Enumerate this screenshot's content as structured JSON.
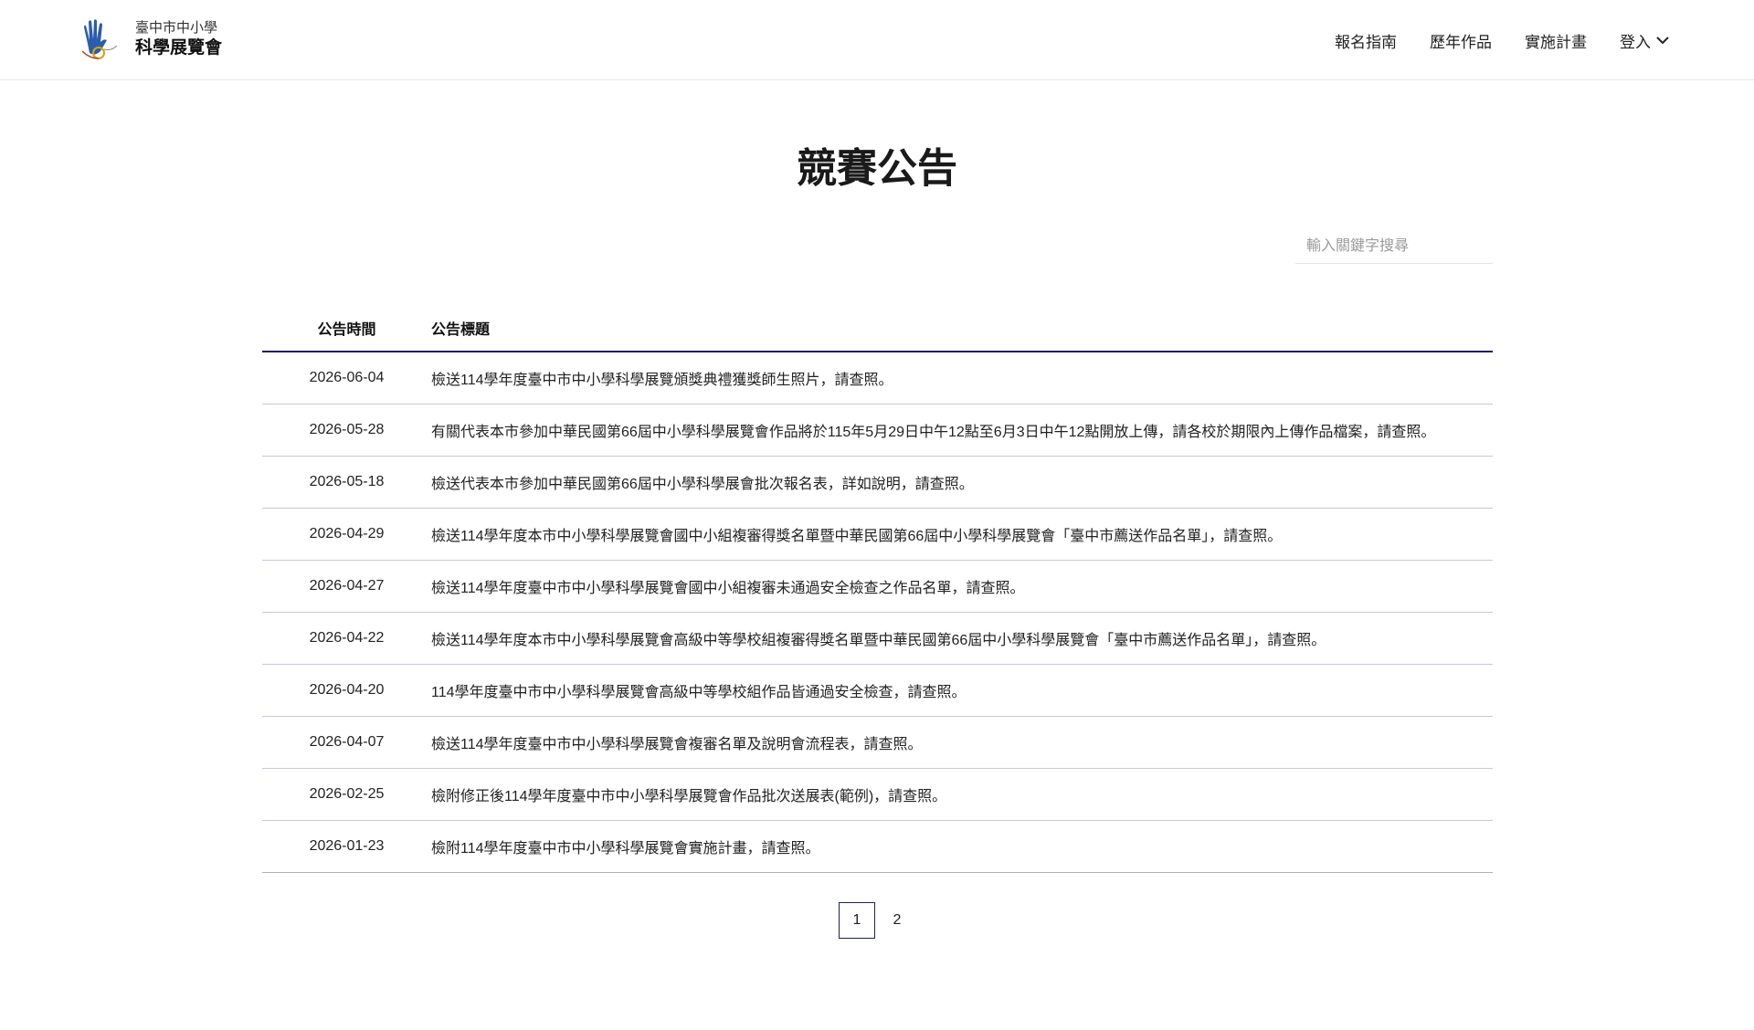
{
  "header": {
    "logo_line1": "臺中市中小學",
    "logo_line2": "科學展覽會",
    "nav": [
      "報名指南",
      "歷年作品",
      "實施計畫",
      "登入"
    ]
  },
  "main": {
    "title": "競賽公告",
    "search_placeholder": "輸入關鍵字搜尋",
    "columns": {
      "date": "公告時間",
      "title": "公告標題"
    },
    "rows": [
      {
        "date": "2026-06-04",
        "title": "檢送114學年度臺中市中小學科學展覽頒獎典禮獲獎師生照片，請查照。"
      },
      {
        "date": "2026-05-28",
        "title": "有關代表本市參加中華民國第66屆中小學科學展覽會作品將於115年5月29日中午12點至6月3日中午12點開放上傳，請各校於期限內上傳作品檔案，請查照。"
      },
      {
        "date": "2026-05-18",
        "title": "檢送代表本市參加中華民國第66屆中小學科學展會批次報名表，詳如說明，請查照。"
      },
      {
        "date": "2026-04-29",
        "title": "檢送114學年度本市中小學科學展覽會國中小組複審得獎名單暨中華民國第66屆中小學科學展覽會「臺中市薦送作品名單」，請查照。"
      },
      {
        "date": "2026-04-27",
        "title": "檢送114學年度臺中市中小學科學展覽會國中小組複審未通過安全檢查之作品名單，請查照。"
      },
      {
        "date": "2026-04-22",
        "title": "檢送114學年度本市中小學科學展覽會高級中等學校組複審得獎名單暨中華民國第66屆中小學科學展覽會「臺中市薦送作品名單」，請查照。"
      },
      {
        "date": "2026-04-20",
        "title": "114學年度臺中市中小學科學展覽會高級中等學校組作品皆通過安全檢查，請查照。"
      },
      {
        "date": "2026-04-07",
        "title": "檢送114學年度臺中市中小學科學展覽會複審名單及說明會流程表，請查照。"
      },
      {
        "date": "2026-02-25",
        "title": "檢附修正後114學年度臺中市中小學科學展覽會作品批次送展表(範例)，請查照。"
      },
      {
        "date": "2026-01-23",
        "title": "檢附114學年度臺中市中小學科學展覽會實施計畫，請查照。"
      }
    ]
  },
  "pagination": {
    "pages": [
      "1",
      "2"
    ],
    "current": "1"
  },
  "colors": {
    "accent": "#1e1f6b",
    "row_border": "#c8c9dd"
  }
}
